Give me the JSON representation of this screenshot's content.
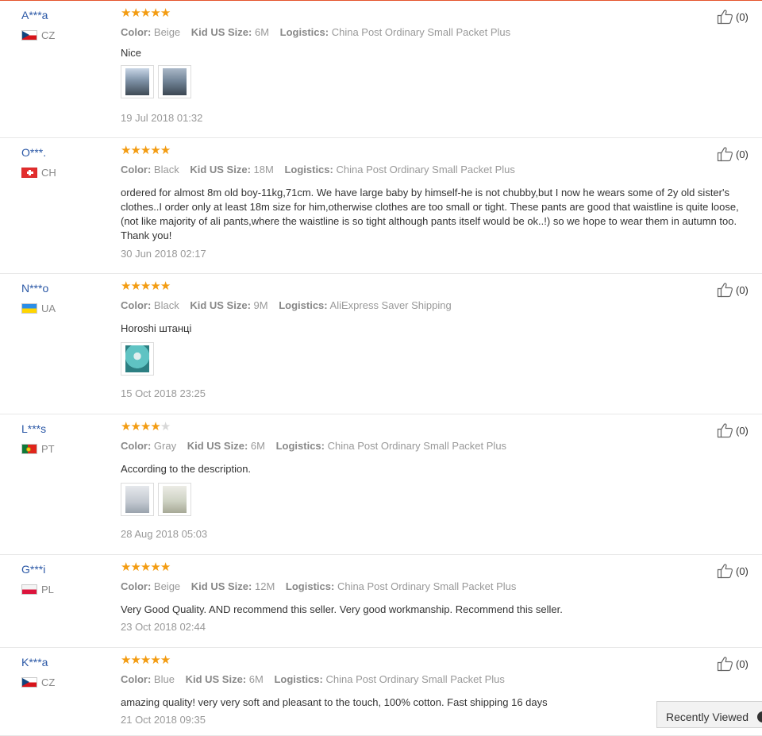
{
  "labels": {
    "color": "Color:",
    "size": "Kid US Size:",
    "logistics": "Logistics:"
  },
  "reviews": [
    {
      "name": "A***a",
      "country": "CZ",
      "flag": "cz",
      "rating": 5,
      "color": "Beige",
      "size": "6M",
      "logistics": "China Post Ordinary Small Packet Plus",
      "text": "Nice",
      "photo_icons": [
        "product-photo-1",
        "product-photo-2"
      ],
      "date": "19 Jul 2018 01:32",
      "likes": "(0)"
    },
    {
      "name": "O***.",
      "country": "CH",
      "flag": "ch",
      "rating": 5,
      "color": "Black",
      "size": "18M",
      "logistics": "China Post Ordinary Small Packet Plus",
      "text": "ordered for almost 8m old boy-11kg,71cm. We have large baby by himself-he is not chubby,but I now he wears some of 2y old sister's clothes..I order only at least 18m size for him,otherwise clothes are too small or tight. These pants are good that waistline is quite loose,(not like majority of ali pants,where the waistline is so tight although pants itself would be ok..!) so we hope to wear them in autumn too. Thank you!",
      "photo_icons": [],
      "date": "30 Jun 2018 02:17",
      "likes": "(0)"
    },
    {
      "name": "N***o",
      "country": "UA",
      "flag": "ua",
      "rating": 5,
      "color": "Black",
      "size": "9M",
      "logistics": "AliExpress Saver Shipping",
      "text": "Horoshi штанці",
      "photo_icons": [
        "product-photo-1"
      ],
      "date": "15 Oct 2018 23:25",
      "likes": "(0)"
    },
    {
      "name": "L***s",
      "country": "PT",
      "flag": "pt",
      "rating": 4,
      "color": "Gray",
      "size": "6M",
      "logistics": "China Post Ordinary Small Packet Plus",
      "text": "According to the description.",
      "photo_icons": [
        "product-photo-1",
        "product-photo-2"
      ],
      "date": "28 Aug 2018 05:03",
      "likes": "(0)"
    },
    {
      "name": "G***i",
      "country": "PL",
      "flag": "pl",
      "rating": 5,
      "color": "Beige",
      "size": "12M",
      "logistics": "China Post Ordinary Small Packet Plus",
      "text": "Very Good Quality. AND recommend this seller. Very good workmanship. Recommend this seller.",
      "photo_icons": [],
      "date": "23 Oct 2018 02:44",
      "likes": "(0)"
    },
    {
      "name": "K***a",
      "country": "CZ",
      "flag": "cz",
      "rating": 5,
      "color": "Blue",
      "size": "6M",
      "logistics": "China Post Ordinary Small Packet Plus",
      "text": "amazing quality! very very soft and pleasant to the touch, 100% cotton. Fast shipping 16 days",
      "photo_icons": [],
      "date": "21 Oct 2018 09:35",
      "likes": "(0)"
    }
  ],
  "recently_viewed": "Recently Viewed",
  "colors": {
    "accent": "#e5542b",
    "star": "#f39c12",
    "name": "#2b58a6"
  }
}
